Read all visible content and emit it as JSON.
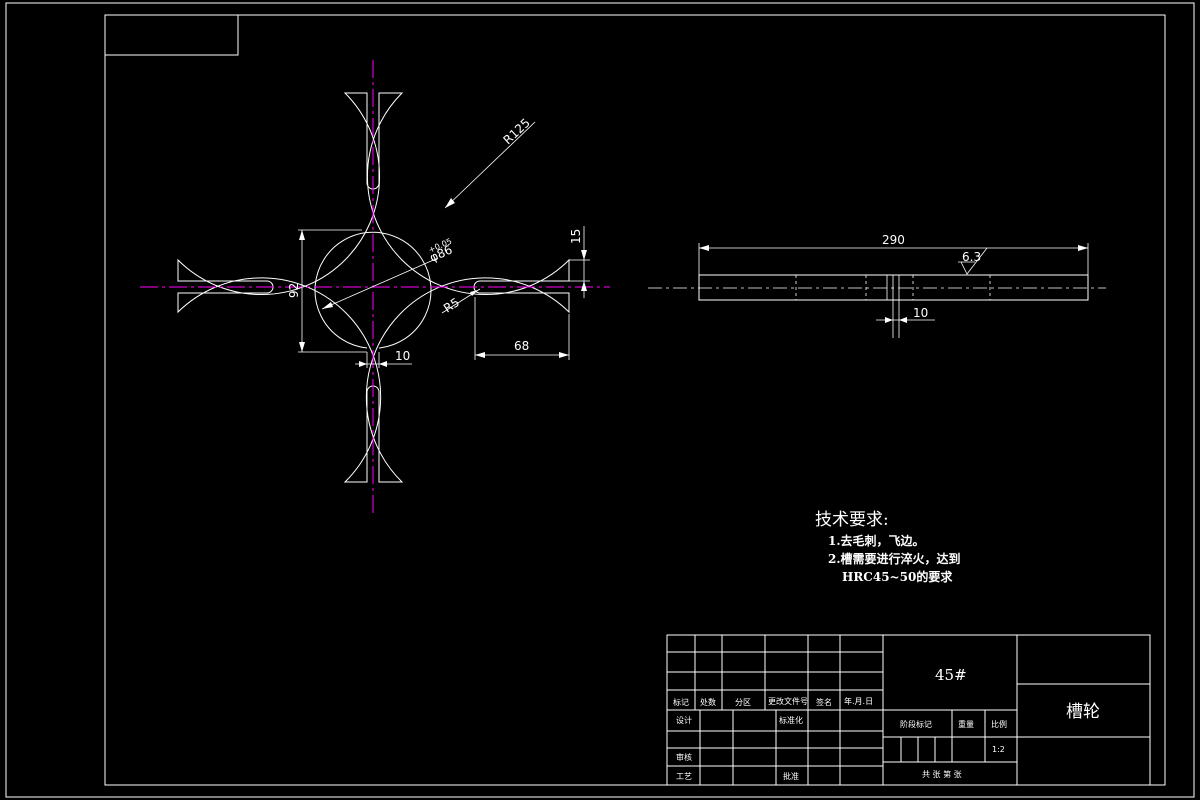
{
  "dimensions": {
    "radius_r125": "R125",
    "diameter_86": "φ86",
    "height_92": "92",
    "slot_10": "10",
    "width_68": "68",
    "height_15": "15",
    "radius_r5": "R5",
    "length_290": "290",
    "thickness_10": "10",
    "roughness": "6.3"
  },
  "tech_requirements": {
    "heading": "技术要求:",
    "item1": "1.去毛刺，飞边。",
    "item2": "2.槽需要进行淬火，达到",
    "item3": "HRC45~50的要求"
  },
  "title_block": {
    "material": "45#",
    "part_name": "槽轮",
    "scale": "1:2",
    "hdr_mark": "标记",
    "hdr_count": "处数",
    "hdr_zone": "分区",
    "hdr_doc": "更改文件号",
    "hdr_sign": "签名",
    "hdr_date": "年.月.日",
    "design": "设计",
    "standardize": "标准化",
    "review": "审核",
    "process": "工艺",
    "approve": "批准",
    "stage": "阶段标记",
    "weight": "重量",
    "ratio": "比例",
    "sheets": "共 张 第 张"
  }
}
